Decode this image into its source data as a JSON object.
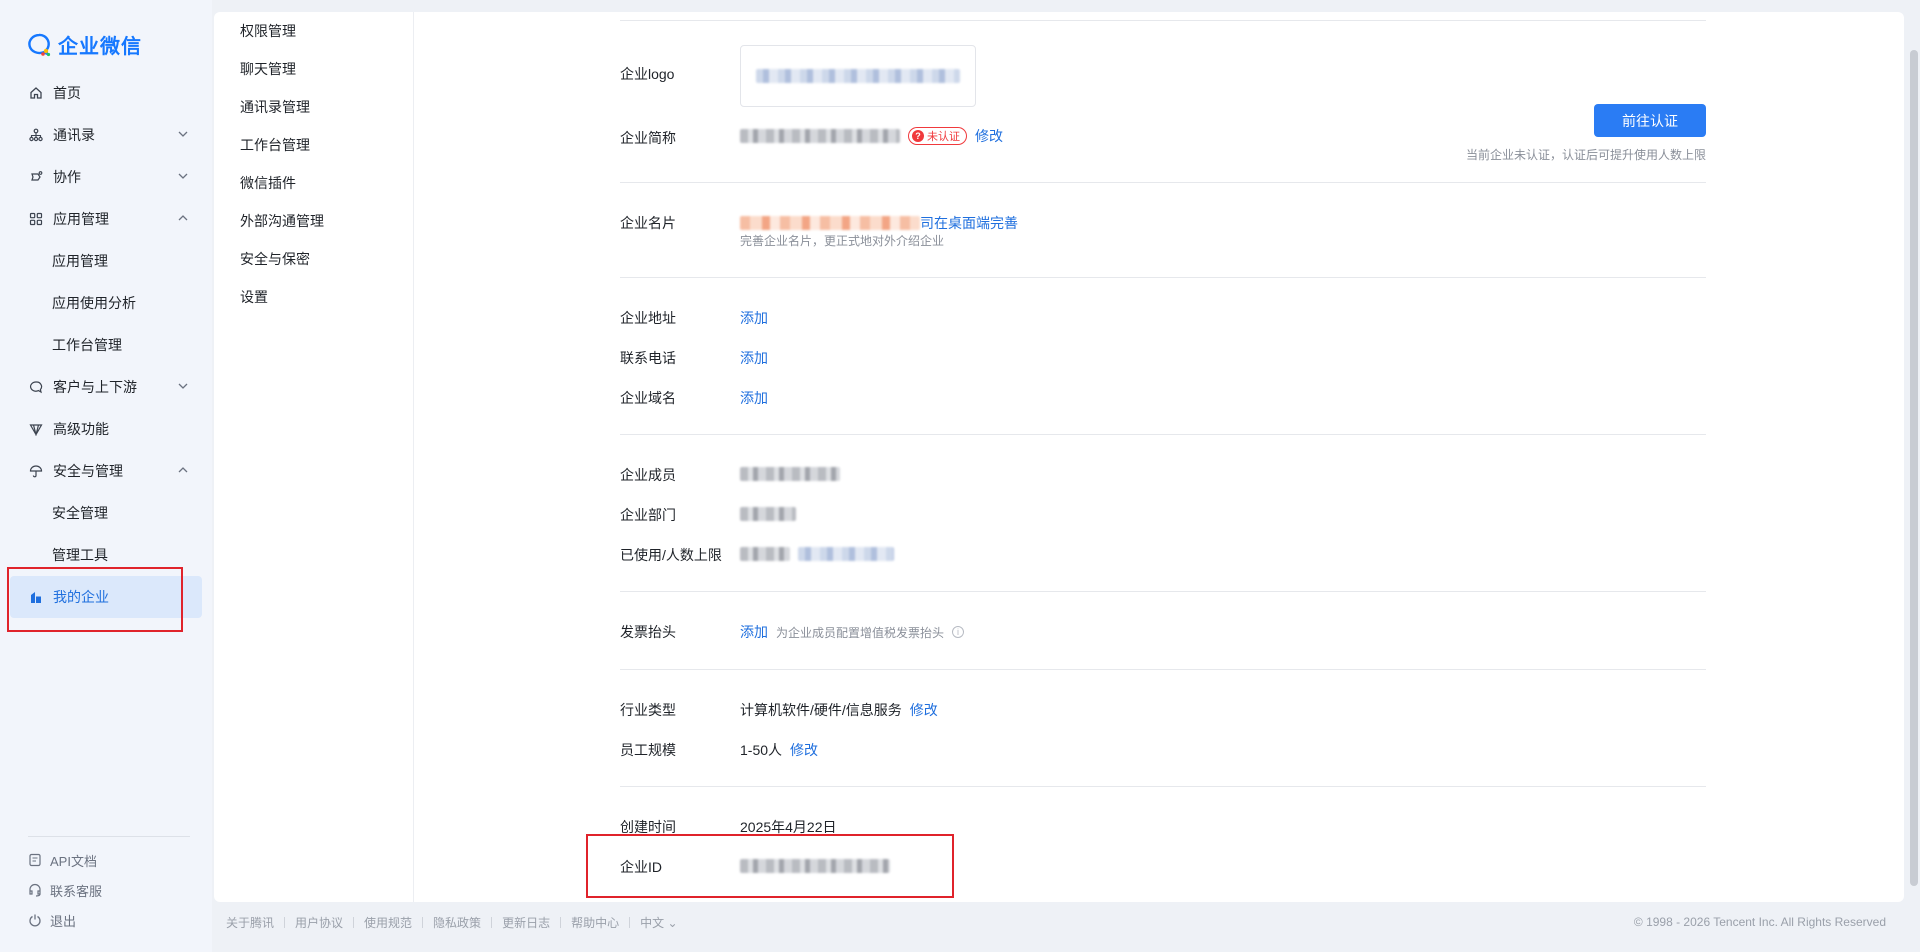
{
  "brand": {
    "name": "企业微信"
  },
  "sidebar": {
    "items": [
      {
        "label": "首页",
        "icon": "home-icon",
        "chevron": ""
      },
      {
        "label": "通讯录",
        "icon": "org-tree-icon",
        "chevron": "down"
      },
      {
        "label": "协作",
        "icon": "collab-icon",
        "chevron": "down"
      },
      {
        "label": "应用管理",
        "icon": "apps-grid-icon",
        "chevron": "up"
      },
      {
        "label": "应用管理",
        "sub": true
      },
      {
        "label": "应用使用分析",
        "sub": true
      },
      {
        "label": "工作台管理",
        "sub": true
      },
      {
        "label": "客户与上下游",
        "icon": "chat-bubble-icon",
        "chevron": "down"
      },
      {
        "label": "高级功能",
        "icon": "diamond-icon",
        "chevron": ""
      },
      {
        "label": "安全与管理",
        "icon": "umbrella-icon",
        "chevron": "up"
      },
      {
        "label": "安全管理",
        "sub": true
      },
      {
        "label": "管理工具",
        "sub": true
      },
      {
        "label": "我的企业",
        "icon": "building-icon",
        "active": true
      }
    ],
    "footer": [
      {
        "label": "API文档",
        "icon": "doc-icon"
      },
      {
        "label": "联系客服",
        "icon": "headset-icon"
      },
      {
        "label": "退出",
        "icon": "power-icon"
      }
    ]
  },
  "subnav": {
    "items": [
      "权限管理",
      "聊天管理",
      "通讯录管理",
      "工作台管理",
      "微信插件",
      "外部沟通管理",
      "安全与保密",
      "设置"
    ]
  },
  "profile": {
    "logo_label": "企业logo",
    "short_name_label": "企业简称",
    "unverified_badge": "未认证",
    "edit": "修改",
    "verify_button": "前往认证",
    "verify_hint": "当前企业未认证，认证后可提升使用人数上限",
    "card_label": "企业名片",
    "card_link_tail": "司在桌面端完善",
    "card_hint": "完善企业名片，更正式地对外介绍企业",
    "address_label": "企业地址",
    "phone_label": "联系电话",
    "domain_label": "企业域名",
    "add": "添加",
    "members_label": "企业成员",
    "depts_label": "企业部门",
    "usage_label": "已使用/人数上限",
    "invoice_label": "发票抬头",
    "invoice_hint": "为企业成员配置增值税发票抬头",
    "industry_label": "行业类型",
    "industry_value": "计算机软件/硬件/信息服务",
    "scale_label": "员工规模",
    "scale_value": "1-50人",
    "created_label": "创建时间",
    "created_value": "2025年4月22日",
    "corp_id_label": "企业ID"
  },
  "footer": {
    "links": [
      "关于腾讯",
      "用户协议",
      "使用规范",
      "隐私政策",
      "更新日志",
      "帮助中心",
      "中文"
    ],
    "copyright": "© 1998 - 2026 Tencent Inc. All Rights Reserved"
  },
  "colors": {
    "accent": "#2a7cf4",
    "link": "#1f6fde",
    "danger": "#f0393c",
    "highlight": "#e0232b"
  }
}
